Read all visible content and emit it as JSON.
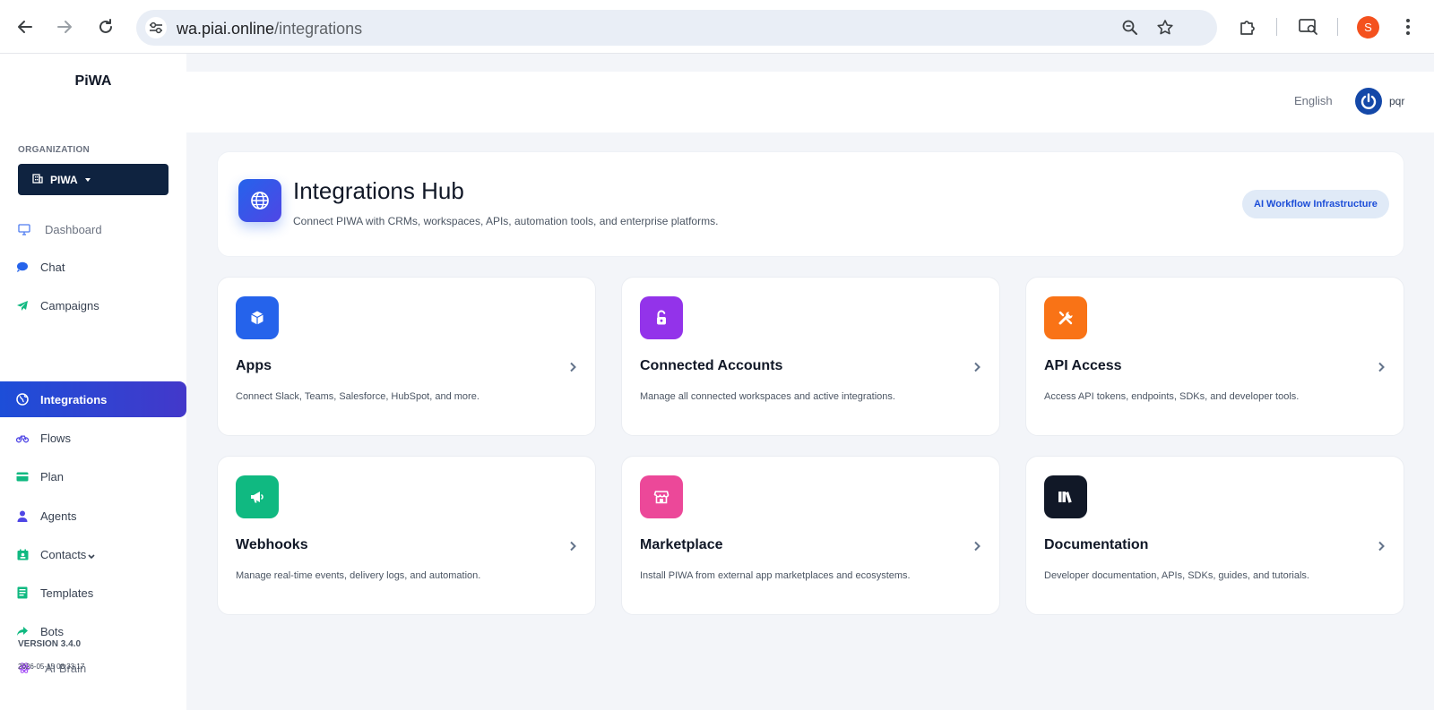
{
  "browser": {
    "url_host": "wa.piai.online",
    "url_path": "/integrations",
    "profile_initial": "S"
  },
  "sidebar": {
    "brand": "PiWA",
    "org_label": "ORGANIZATION",
    "org_name": "PIWA",
    "items": [
      {
        "label": "Dashboard",
        "icon": "monitor-icon"
      },
      {
        "label": "Chat",
        "icon": "chat-bubble-icon"
      },
      {
        "label": "Campaigns",
        "icon": "paper-plane-icon"
      },
      {
        "label": "Integrations",
        "icon": "globe-icon"
      },
      {
        "label": "Flows",
        "icon": "bicycle-icon"
      },
      {
        "label": "Plan",
        "icon": "card-icon"
      },
      {
        "label": "Agents",
        "icon": "user-icon"
      },
      {
        "label": "Contacts",
        "icon": "address-book-icon"
      },
      {
        "label": "Templates",
        "icon": "document-icon"
      },
      {
        "label": "Bots",
        "icon": "share-arrow-icon"
      },
      {
        "label": "AI Brain",
        "icon": "atom-icon"
      }
    ],
    "version": "VERSION 3.4.0",
    "timestamp": "2026-05-15 08:33:17"
  },
  "header": {
    "language": "English",
    "user": "pqr"
  },
  "hub": {
    "title": "Integrations Hub",
    "subtitle": "Connect PIWA with CRMs, workspaces, APIs, automation tools, and enterprise platforms.",
    "badge": "AI Workflow Infrastructure"
  },
  "cards": [
    {
      "title": "Apps",
      "desc": "Connect Slack, Teams, Salesforce, HubSpot, and more.",
      "icon": "cube-icon",
      "color": "#2563eb"
    },
    {
      "title": "Connected Accounts",
      "desc": "Manage all connected workspaces and active integrations.",
      "icon": "unlock-icon",
      "color": "#9333ea"
    },
    {
      "title": "API Access",
      "desc": "Access API tokens, endpoints, SDKs, and developer tools.",
      "icon": "tools-icon",
      "color": "#f97316"
    },
    {
      "title": "Webhooks",
      "desc": "Manage real-time events, delivery logs, and automation.",
      "icon": "megaphone-icon",
      "color": "#10b981"
    },
    {
      "title": "Marketplace",
      "desc": "Install PIWA from external app marketplaces and ecosystems.",
      "icon": "store-icon",
      "color": "#ec4899"
    },
    {
      "title": "Documentation",
      "desc": "Developer documentation, APIs, SDKs, guides, and tutorials.",
      "icon": "books-icon",
      "color": "#111827"
    }
  ]
}
